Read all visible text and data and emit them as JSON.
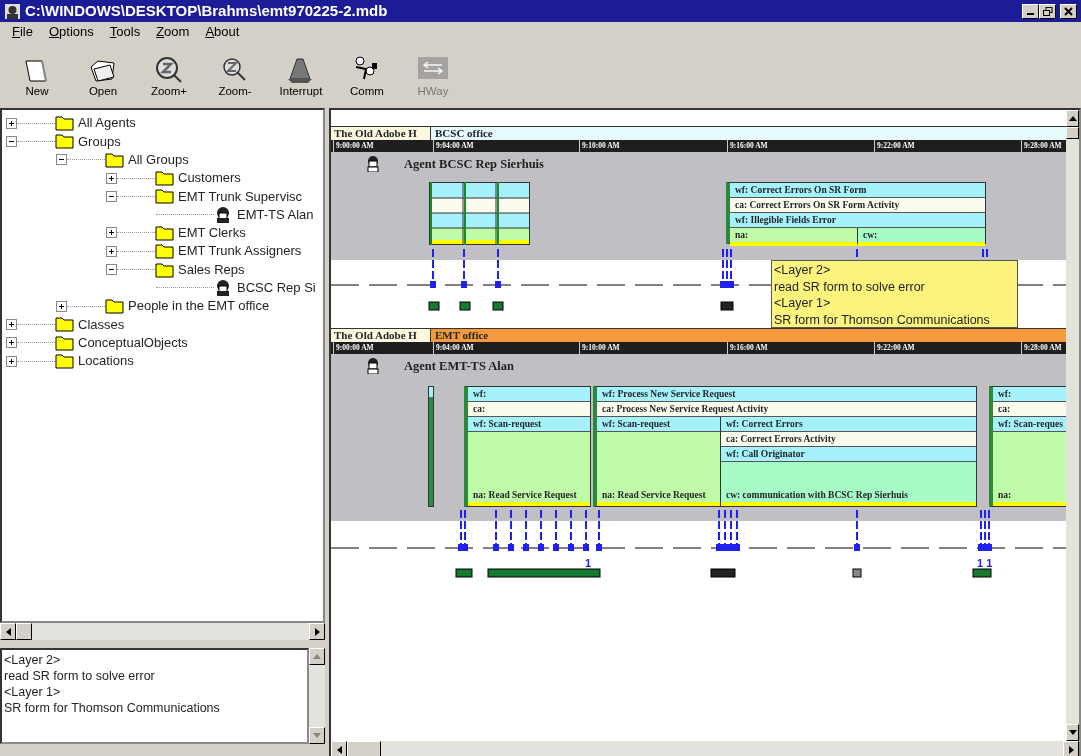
{
  "window": {
    "title": "C:\\WINDOWS\\DESKTOP\\Brahms\\emt970225-2.mdb"
  },
  "menu": [
    {
      "label": "File"
    },
    {
      "label": "Options"
    },
    {
      "label": "Tools"
    },
    {
      "label": "Zoom"
    },
    {
      "label": "About"
    }
  ],
  "toolbar": [
    {
      "kind": "new",
      "label": "New",
      "disabled": false
    },
    {
      "kind": "open",
      "label": "Open",
      "disabled": false
    },
    {
      "kind": "zoom-in",
      "label": "Zoom+",
      "disabled": false
    },
    {
      "kind": "zoom-out",
      "label": "Zoom-",
      "disabled": false
    },
    {
      "kind": "interrupt",
      "label": "Interrupt",
      "disabled": false
    },
    {
      "kind": "comm",
      "label": "Comm",
      "disabled": false
    },
    {
      "kind": "hway",
      "label": "HWay",
      "disabled": true
    }
  ],
  "tree": [
    {
      "kind": "folder",
      "label": "All Agents",
      "expanded": false
    },
    {
      "kind": "folder",
      "label": "Groups",
      "expanded": true,
      "children": [
        {
          "kind": "folder",
          "label": "All Groups",
          "expanded": true,
          "children": [
            {
              "kind": "folder",
              "label": "Customers",
              "expanded": false
            },
            {
              "kind": "folder",
              "label": "EMT Trunk Supervisc",
              "expanded": true,
              "children": [
                {
                  "kind": "agent",
                  "label": "EMT-TS Alan"
                }
              ]
            },
            {
              "kind": "folder",
              "label": "EMT Clerks",
              "expanded": false
            },
            {
              "kind": "folder",
              "label": "EMT Trunk Assigners",
              "expanded": false
            },
            {
              "kind": "folder",
              "label": "Sales Reps",
              "expanded": true,
              "children": [
                {
                  "kind": "agent",
                  "label": "BCSC Rep Si"
                }
              ]
            }
          ]
        },
        {
          "kind": "folder",
          "label": "People in the EMT office",
          "expanded": false
        }
      ]
    },
    {
      "kind": "folder",
      "label": "Classes",
      "expanded": false
    },
    {
      "kind": "folder",
      "label": "ConceptualObjects",
      "expanded": false
    },
    {
      "kind": "folder",
      "label": "Locations",
      "expanded": false
    }
  ],
  "description": {
    "lines": [
      "<Layer 2>",
      "read SR form to solve error",
      "<Layer 1>",
      "SR form for Thomson Communications"
    ]
  },
  "timeline": {
    "lanes": [
      {
        "location": "The Old Adobe H",
        "area": "BCSC office",
        "color": "#e6fcfc",
        "ticks": [
          "9:00:00 AM",
          "9:04:00 AM",
          "9:10:00 AM",
          "9:16:00 AM",
          "9:22:00 AM",
          "9:28:00 AM"
        ],
        "agent": "Agent BCSC Rep Sierhuis",
        "blocks": [
          {
            "cells": [
              {
                "kind": "wf",
                "text": "wf: Correct Errors On SR Form"
              },
              {
                "kind": "ca",
                "text": "ca: Correct Errors On SR Form Activity"
              },
              {
                "kind": "wf",
                "text": "wf: Illegible Fields Error"
              }
            ],
            "split": [
              [
                {
                  "kind": "na",
                  "text": "na:"
                }
              ],
              [
                {
                  "kind": "cw",
                  "text": "cw:"
                }
              ]
            ]
          }
        ]
      },
      {
        "location": "The Old Adobe H",
        "area": "EMT office",
        "color": "#f49a3c",
        "ticks": [
          "9:00:00 AM",
          "9:04:00 AM",
          "9:10:00 AM",
          "9:16:00 AM",
          "9:22:00 AM",
          "9:28:00 AM"
        ],
        "agent": "Agent EMT-TS Alan",
        "blocks": [
          {
            "cells": [
              {
                "kind": "wf",
                "text": "wf:"
              },
              {
                "kind": "ca",
                "text": "ca:"
              },
              {
                "kind": "wf",
                "text": "wf: Scan-request"
              },
              {
                "kind": "na",
                "text": "na: Read Service Request"
              }
            ]
          },
          {
            "cells": [
              {
                "kind": "wf",
                "text": "wf: Process New Service Request"
              },
              {
                "kind": "ca",
                "text": "ca: Process New Service Request Activity"
              }
            ],
            "split": [
              [
                {
                  "kind": "wf",
                  "text": "wf: Scan-request"
                },
                {
                  "kind": "na",
                  "text": "na: Read Service Request"
                }
              ],
              [
                {
                  "kind": "wf",
                  "text": "wf: Correct Errors"
                },
                {
                  "kind": "ca",
                  "text": "ca: Correct Errors Activity"
                },
                {
                  "kind": "wf",
                  "text": "wf: Call Originator"
                },
                {
                  "kind": "cw",
                  "text": "cw: communication with BCSC Rep Sierhuis"
                }
              ]
            ]
          },
          {
            "cells": [
              {
                "kind": "wf",
                "text": "wf:"
              },
              {
                "kind": "ca",
                "text": "ca:"
              },
              {
                "kind": "wf",
                "text": "wf: Scan-reques"
              },
              {
                "kind": "na",
                "text": "na:"
              }
            ]
          }
        ],
        "counts": [
          "1",
          "1 1"
        ]
      }
    ]
  },
  "tooltip": {
    "lines": [
      "<Layer 2>",
      "read SR form to solve error",
      "<Layer 1>",
      "SR form for Thomson Communications"
    ]
  }
}
